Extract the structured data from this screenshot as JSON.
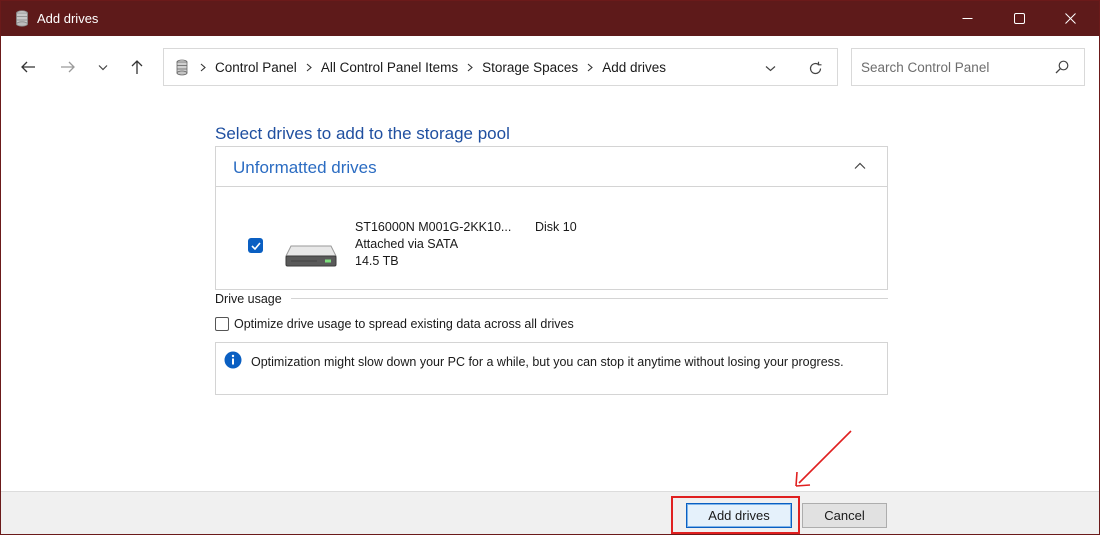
{
  "window": {
    "title": "Add drives",
    "icon": "storage-spaces-icon",
    "controls": [
      "minimize-icon",
      "maximize-icon",
      "close-icon"
    ]
  },
  "nav": {
    "back_icon": "back-arrow-icon",
    "forward_icon": "forward-arrow-icon",
    "recent_icon": "chevron-down-icon",
    "up_icon": "up-arrow-icon"
  },
  "breadcrumbs": [
    "Control Panel",
    "All Control Panel Items",
    "Storage Spaces",
    "Add drives"
  ],
  "search": {
    "placeholder": "Search Control Panel",
    "value": ""
  },
  "main": {
    "heading": "Select drives to add to the storage pool",
    "group_title": "Unformatted drives",
    "drive": {
      "checked": true,
      "name": "ST16000N M001G-2KK10...",
      "connection": "Attached via SATA",
      "size": "14.5 TB",
      "disk": "Disk 10"
    },
    "usage_label": "Drive usage",
    "optimize_label": "Optimize drive usage to spread existing data across all drives",
    "optimize_checked": false,
    "info_text": "Optimization might slow down your PC for a while, but you can stop it anytime without losing your progress."
  },
  "footer": {
    "add_label": "Add drives",
    "cancel_label": "Cancel"
  },
  "colors": {
    "titlebar": "#5e1a1a",
    "accent": "#0a5fc2",
    "heading": "#1f4fa0",
    "annotation": "#e02020"
  }
}
